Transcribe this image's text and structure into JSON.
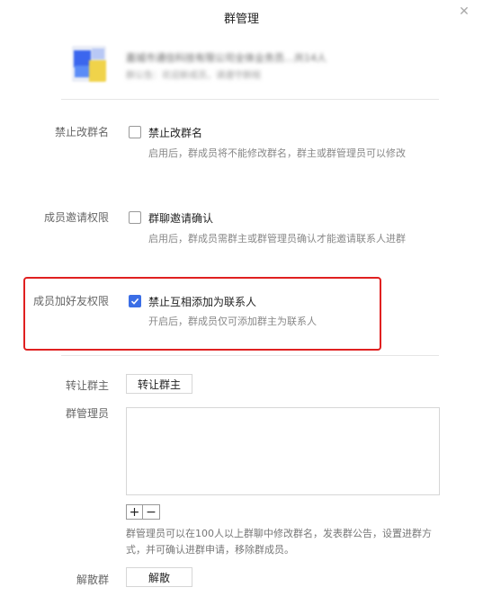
{
  "dialog": {
    "title": "群管理",
    "close_glyph": "✕"
  },
  "group": {
    "name": "嘉城市通信科技有限公司全体业务员…共14人",
    "description": "群公告：欢迎新成员，请遵守群规"
  },
  "rename": {
    "label": "禁止改群名",
    "option": "禁止改群名",
    "checked": false,
    "description": "启用后，群成员将不能修改群名，群主或群管理员可以修改"
  },
  "invite": {
    "label": "成员邀请权限",
    "option": "群聊邀请确认",
    "checked": false,
    "description": "启用后，群成员需群主或群管理员确认才能邀请联系人进群"
  },
  "friend": {
    "label": "成员加好友权限",
    "option": "禁止互相添加为联系人",
    "checked": true,
    "description": "开启后，群成员仅可添加群主为联系人"
  },
  "transfer": {
    "label": "转让群主",
    "button": "转让群主"
  },
  "admins": {
    "label": "群管理员",
    "add_glyph": "+",
    "remove_glyph": "−",
    "note": "群管理员可以在100人以上群聊中修改群名，发表群公告，设置进群方式，并可确认进群申请，移除群成员。"
  },
  "dissolve": {
    "label": "解散群",
    "button": "解散"
  },
  "colors": {
    "accent": "#3b6ee6",
    "highlight": "#e02020"
  }
}
